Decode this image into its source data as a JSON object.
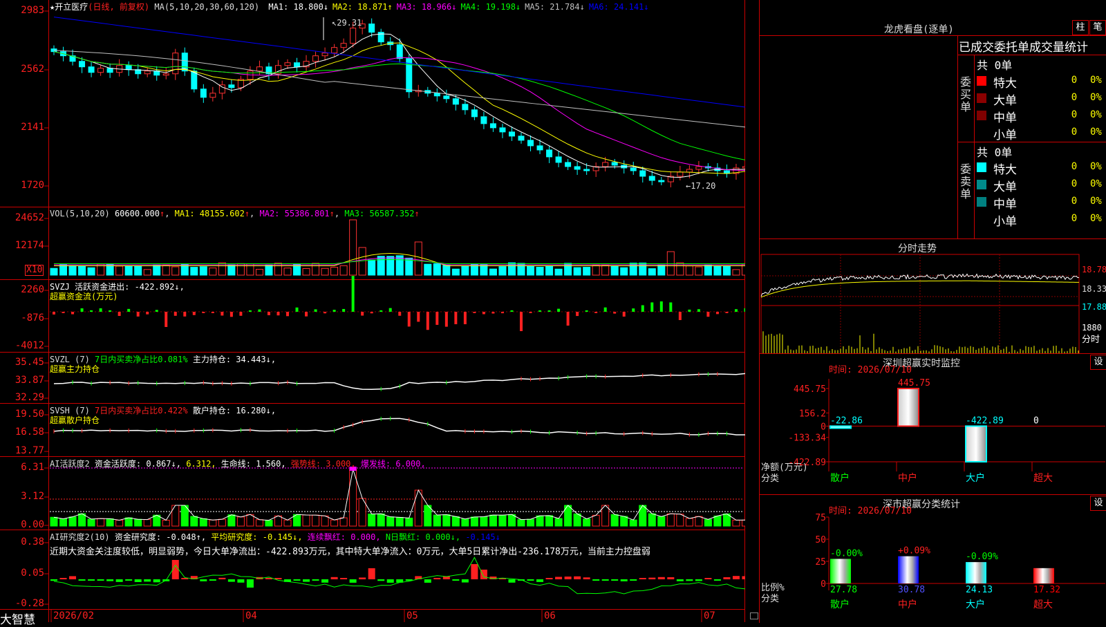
{
  "stock": {
    "star": "★",
    "name": "开立医疗",
    "period": "(日线, 前复权)"
  },
  "main": {
    "ma_label": "MA(5,10,20,30,60,120)",
    "ma": [
      {
        "name": "MA1",
        "value": "18.800",
        "arrow": "↓",
        "color": "#ffffff"
      },
      {
        "name": "MA2",
        "value": "18.871",
        "arrow": "↑",
        "color": "#ffff00"
      },
      {
        "name": "MA3",
        "value": "18.966",
        "arrow": "↓",
        "color": "#ff00ff"
      },
      {
        "name": "MA4",
        "value": "19.198",
        "arrow": "↓",
        "color": "#00ff00"
      },
      {
        "name": "MA5",
        "value": "21.784",
        "arrow": "↓",
        "color": "#c0c0c0"
      },
      {
        "name": "MA6",
        "value": "24.141",
        "arrow": "↓",
        "color": "#0000ff"
      }
    ],
    "y_ticks": [
      "2983",
      "2562",
      "2141",
      "1720"
    ],
    "high_label": "29.31",
    "low_label": "←17.20"
  },
  "vol": {
    "label": "VOL(5,10,20)",
    "value": "60600.000",
    "ma1": "MA1: 48155.602",
    "ma2": "MA2: 55386.801",
    "ma3": "MA3: 56587.352",
    "y_ticks": [
      "24652",
      "12174"
    ],
    "x10": "X10"
  },
  "svzj": {
    "line1": "SVZJ  活跃资金进出: -422.892↓,",
    "line2": "超赢资金流(万元)",
    "y_ticks": [
      "2260",
      "-876",
      "-4012"
    ]
  },
  "svzl": {
    "prefix": "SVZL (7)",
    "desc": "7日内买卖净占比0.081%",
    "hold": "主力持仓: 34.443↓,",
    "line2": "超赢主力持仓",
    "y_ticks": [
      "35.45",
      "33.87",
      "32.29"
    ]
  },
  "svsh": {
    "prefix": "SVSH (7)",
    "desc": "7日内买卖净占比0.422%",
    "hold": "散户持仓: 16.280↓,",
    "line2": "超赢散户持仓",
    "y_ticks": [
      "19.50",
      "16.58",
      "13.77"
    ]
  },
  "ai": {
    "a": "AI活跃度2",
    "b": "资金活跃度: 0.867↓,",
    "c": "6.312,",
    "d": "生命线: 1.560,",
    "e": "强势线: 3.000,",
    "f": "爆发线: 6.000,",
    "y_ticks": [
      "6.31",
      "3.12",
      "0.00"
    ]
  },
  "ai2": {
    "a": "AI研究度2(10)",
    "b": "资金研究度: -0.048↑,",
    "c": "平均研究度: -0.145↓,",
    "d": "连续飘红: 0.000,",
    "e": "N日飘红: 0.000↓,",
    "f": "-0.145↓",
    "comment": "近期大资金关注度较低，明显弱势，今日大单净流出：-422.893万元，其中特大单净流入：0万元，大单5日累计净出-236.178万元，当前主力控盘弱",
    "y_ticks": [
      "0.38",
      "0.05",
      "-0.28"
    ]
  },
  "x_axis": {
    "labels": [
      "2026/02",
      "04",
      "05",
      "06",
      "07"
    ],
    "brand": "大智慧"
  },
  "dragon": {
    "title": "龙虎看盘(逐单)",
    "btn1": "柱",
    "btn2": "笔",
    "header": "已成交委托单成交量统计",
    "buy_label": "委买单",
    "sell_label": "委卖单",
    "total_buy": "共 0单",
    "total_sell": "共 0单",
    "buy_rows": [
      {
        "name": "特大",
        "count": "0",
        "pct": "0%",
        "color": "#ff0000"
      },
      {
        "name": "大单",
        "count": "0",
        "pct": "0%",
        "color": "#8b0000"
      },
      {
        "name": "中单",
        "count": "0",
        "pct": "0%",
        "color": "#800000"
      },
      {
        "name": "小单",
        "count": "0",
        "pct": "0%",
        "color": ""
      }
    ],
    "sell_rows": [
      {
        "name": "特大",
        "count": "0",
        "pct": "0%",
        "color": "#00ffff"
      },
      {
        "name": "大单",
        "count": "0",
        "pct": "0%",
        "color": "#008b8b"
      },
      {
        "name": "中单",
        "count": "0",
        "pct": "0%",
        "color": "#008080"
      },
      {
        "name": "小单",
        "count": "0",
        "pct": "0%",
        "color": ""
      }
    ]
  },
  "fenshi": {
    "title": "分时走势",
    "y_ticks": [
      "18.78",
      "18.33",
      "17.88"
    ],
    "vol_label": "1880",
    "x_label": "分时"
  },
  "monitor": {
    "title": "深圳超赢实时监控",
    "btn": "设",
    "time": "时间: 2026/07/10",
    "y_ticks": [
      "445.75",
      "156.2",
      "0",
      "-133.34",
      "-422.89"
    ],
    "unit1": "净额(万元)",
    "unit2": "分类",
    "cats": [
      "散户",
      "中户",
      "大户",
      "超大"
    ],
    "values": [
      -22.86,
      445.75,
      -422.89,
      0
    ],
    "value_labels": [
      "-22.86",
      "445.75",
      "-422.89",
      "0"
    ]
  },
  "classify": {
    "title": "深市超赢分类统计",
    "btn": "设",
    "time": "时间: 2026/07/10",
    "y_ticks": [
      "75",
      "50",
      "25",
      "0"
    ],
    "unit1": "比例%",
    "unit2": "分类",
    "cats": [
      "散户",
      "中户",
      "大户",
      "超大"
    ],
    "values": [
      27.78,
      30.78,
      24.13,
      17.32
    ],
    "value_labels": [
      "27.78",
      "30.78",
      "24.13",
      "17.32"
    ],
    "changes": [
      "-0.00%",
      "+0.09%",
      "-0.09%",
      ""
    ],
    "colors": [
      "#00ff00",
      "#0000ff",
      "#00ffff",
      "#ff0000"
    ]
  },
  "chart_data": {
    "type": "candlestick",
    "title": "开立医疗",
    "dates": [
      "2026/02",
      "04",
      "05",
      "06",
      "07"
    ],
    "price_ylim": [
      17.2,
      29.83
    ],
    "high": 29.31,
    "low": 17.2,
    "close_approx": [
      26.9,
      26.6,
      26.2,
      25.8,
      25.4,
      25.7,
      25.4,
      25.9,
      25.6,
      25.3,
      25.5,
      25.2,
      25.3,
      26.8,
      25.5,
      24.2,
      23.6,
      23.9,
      24.5,
      24.3,
      24.9,
      25.5,
      25.8,
      25.3,
      25.9,
      26.1,
      25.8,
      26.2,
      26.6,
      26.8,
      27.2,
      27.5,
      28.6,
      28.9,
      28.3,
      27.6,
      27.4,
      26.4,
      24.0,
      24.1,
      23.9,
      23.7,
      23.5,
      23.1,
      22.7,
      22.2,
      21.7,
      21.4,
      21.1,
      20.8,
      20.5,
      20.1,
      19.8,
      19.3,
      18.9,
      18.6,
      18.4,
      18.3,
      18.6,
      18.9,
      18.7,
      18.5,
      18.3,
      17.9,
      17.6,
      17.5,
      17.9,
      18.2,
      18.4,
      18.6,
      18.5,
      18.3,
      18.1,
      18.5,
      18.6,
      18.8
    ]
  }
}
